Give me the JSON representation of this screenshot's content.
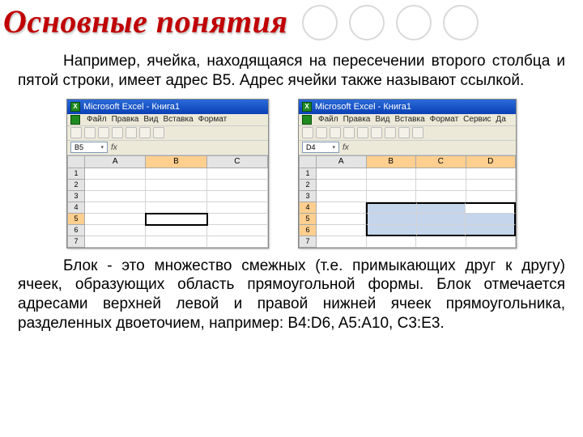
{
  "title": "Основные понятия",
  "paragraph1": "Например, ячейка, находящаяся на пересечении второго столбца и пятой строки, имеет адрес B5. Адрес ячейки также называют ссылкой.",
  "paragraph2": "Блок - это множество смежных (т.е. примыкающих друг к другу) ячеек, образующих область прямоугольной формы. Блок отмечается адресами верхней левой и правой нижней ячеек прямоугольника, разделенных двоеточием, например: B4:D6, A5:A10, C3:E3.",
  "excel_left": {
    "window_title": "Microsoft Excel - Книга1",
    "menu": [
      "Файл",
      "Правка",
      "Вид",
      "Вставка",
      "Формат"
    ],
    "namebox": "B5",
    "columns": [
      "A",
      "B",
      "C"
    ],
    "rows": [
      "1",
      "2",
      "3",
      "4",
      "5",
      "6",
      "7"
    ],
    "active_cell": "B5"
  },
  "excel_right": {
    "window_title": "Microsoft Excel - Книга1",
    "menu": [
      "Файл",
      "Правка",
      "Вид",
      "Вставка",
      "Формат",
      "Сервис",
      "Да"
    ],
    "namebox": "D4",
    "columns": [
      "A",
      "B",
      "C",
      "D"
    ],
    "rows": [
      "1",
      "2",
      "3",
      "4",
      "5",
      "6",
      "7"
    ],
    "selection": "B4:D6"
  }
}
